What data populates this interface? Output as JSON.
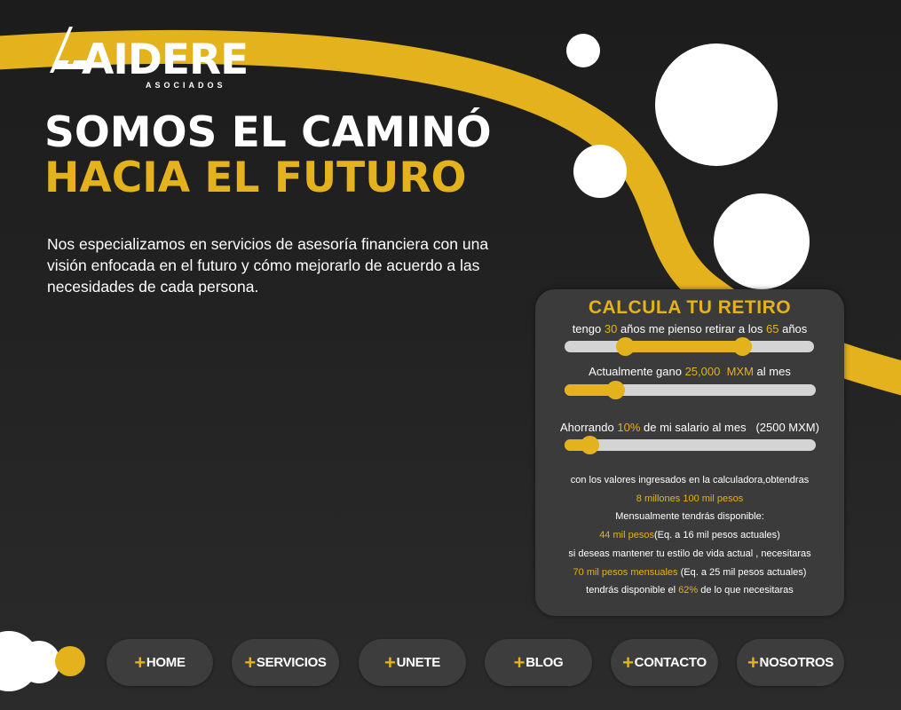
{
  "brand": {
    "logo_text": "AIDERE",
    "logo_subtext": "ASOCIADOS",
    "accent_color": "#e3b21c",
    "background_color": "#232323"
  },
  "hero": {
    "headline_line1": "SOMOS EL CAMINÓ",
    "headline_line2": "HACIA EL FUTURO",
    "description": "Nos especializamos en servicios de asesoría financiera con una visión enfocada en el futuro y cómo mejorarlo de acuerdo a las necesidades de cada persona."
  },
  "calculator": {
    "title": "CALCULA TU RETIRO",
    "age_row": {
      "prefix": "tengo",
      "current_age": "30",
      "middle": "años me pienso retirar a los",
      "retire_age": "65",
      "suffix": "años"
    },
    "age_range": {
      "min": 18,
      "max": 80,
      "low": 30,
      "high": 65
    },
    "income_row": {
      "prefix": "Actualmente gano",
      "amount": "25,000  MXM",
      "suffix": "al mes"
    },
    "income_fraction": 0.18,
    "savings_row": {
      "prefix": "Ahorrando",
      "percent": "10%",
      "suffix": "de mi salario al mes   (2500 MXM)"
    },
    "savings_fraction": 0.07,
    "results": {
      "line1": "con los valores ingresados en la calculadora,obtendras",
      "line2": "8 millones 100 mil pesos",
      "line3": "Mensualmente tendrás disponible:",
      "line4_hl": "44 mil pesos",
      "line4_rest": "(Eq. a 16 mil pesos actuales)",
      "line5": "si deseas mantener tu estilo de vida actual , necesitaras",
      "line6_hl": "70 mil pesos mensuales",
      "line6_rest": " (Eq. a 25 mil pesos actuales)",
      "line7_pre": "tendrás disponible el ",
      "line7_hl": "62%",
      "line7_post": " de lo que necesitaras"
    }
  },
  "nav": {
    "plus_icon": "+",
    "items": [
      "HOME",
      "SERVICIOS",
      "UNETE",
      "BLOG",
      "CONTACTO",
      "NOSOTROS"
    ]
  }
}
